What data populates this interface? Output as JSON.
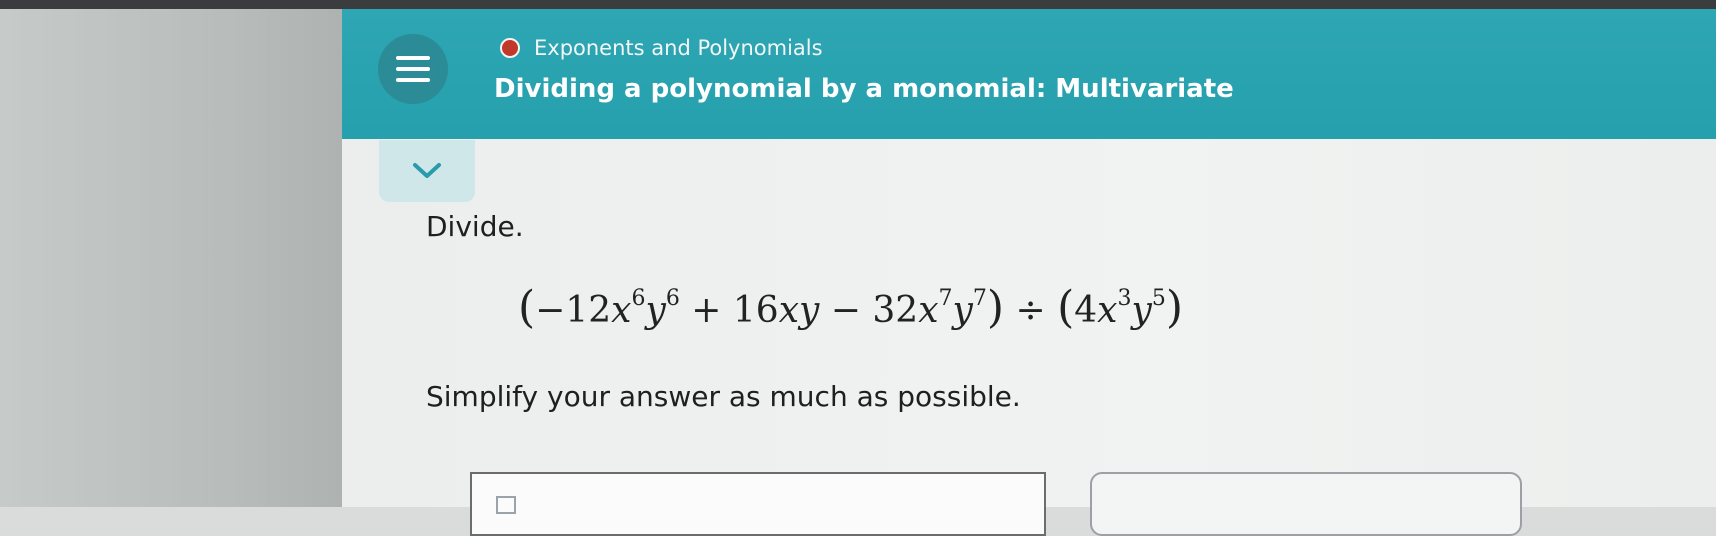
{
  "header": {
    "topic": "Exponents and Polynomials",
    "title": "Dividing a polynomial by a monomial: Multivariate",
    "colors": {
      "header_bg": "#28a1af",
      "topic_dot": "#c0392b"
    }
  },
  "icons": {
    "menu": "hamburger-icon",
    "collapse": "chevron-down-icon"
  },
  "problem": {
    "prompt": "Divide.",
    "expression": {
      "open1": "(",
      "t1_coef": "−12",
      "t1_x": "x",
      "t1_xexp": "6",
      "t1_y": "y",
      "t1_yexp": "6",
      "op1": " + ",
      "t2": "16",
      "t2_xy": "xy",
      "op2": " − ",
      "t3_coef": "32",
      "t3_x": "x",
      "t3_xexp": "7",
      "t3_y": "y",
      "t3_yexp": "7",
      "close1": ")",
      "divide": " ÷ ",
      "open2": "(",
      "d_coef": "4",
      "d_x": "x",
      "d_xexp": "3",
      "d_y": "y",
      "d_yexp": "5",
      "close2": ")"
    },
    "instruction": "Simplify your answer as much as possible."
  }
}
